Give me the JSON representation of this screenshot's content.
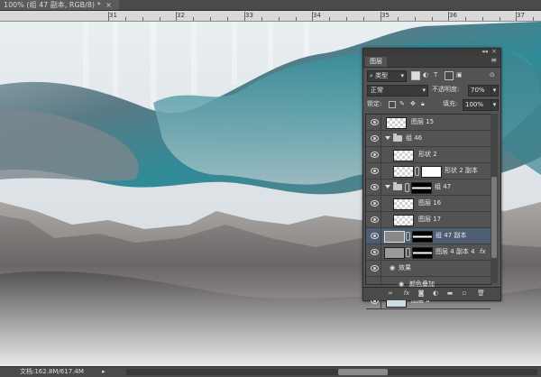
{
  "document": {
    "tab_title": "100% (组 47 副本, RGB/8) *",
    "close_glyph": "×"
  },
  "rulers": {
    "top_labels": [
      "31",
      "32",
      "33",
      "34",
      "35",
      "36",
      "37"
    ]
  },
  "layers_panel": {
    "tab_label": "图层",
    "collapse_glyph": "◂◂",
    "close_glyph": "×",
    "menu_glyph": "≡",
    "filter": {
      "label": "类型",
      "toggle_glyph": "⊙"
    },
    "blend_mode": "正常",
    "opacity": {
      "label": "不透明度:",
      "value": "70%"
    },
    "lock_label": "锁定:",
    "fill": {
      "label": "填充:",
      "value": "100%"
    },
    "layers": [
      {
        "name": "图层 15",
        "type": "layer",
        "indent": 0
      },
      {
        "name": "组 46",
        "type": "group",
        "indent": 0
      },
      {
        "name": "形状 2",
        "type": "layer",
        "indent": 1
      },
      {
        "name": "形状 2 副本",
        "type": "layer-mask",
        "indent": 1
      },
      {
        "name": "组 47",
        "type": "group-mask",
        "indent": 0
      },
      {
        "name": "图层 16",
        "type": "layer",
        "indent": 1
      },
      {
        "name": "图层 17",
        "type": "layer",
        "indent": 1
      },
      {
        "name": "组 47 副本",
        "type": "layer-mask",
        "indent": 0,
        "selected": true
      },
      {
        "name": "图层 4 副本 4",
        "type": "layer-mask-fx",
        "indent": 0,
        "fx": "fx"
      },
      {
        "name": "效果",
        "type": "effects",
        "indent": 1
      },
      {
        "name": "颜色叠加",
        "type": "effect",
        "indent": 2
      },
      {
        "name": "图层 0",
        "type": "layer",
        "indent": 0
      }
    ],
    "footer_icons": [
      "link-icon",
      "fx-icon",
      "mask-icon",
      "adjustment-icon",
      "folder-icon",
      "new-layer-icon",
      "trash-icon"
    ]
  },
  "status_bar": {
    "doc_info": "文档:162.8M/617.4M"
  },
  "colors": {
    "panel_bg": "#535353",
    "selected_row": "#4e5d72",
    "teal": "#3f8e9a"
  }
}
